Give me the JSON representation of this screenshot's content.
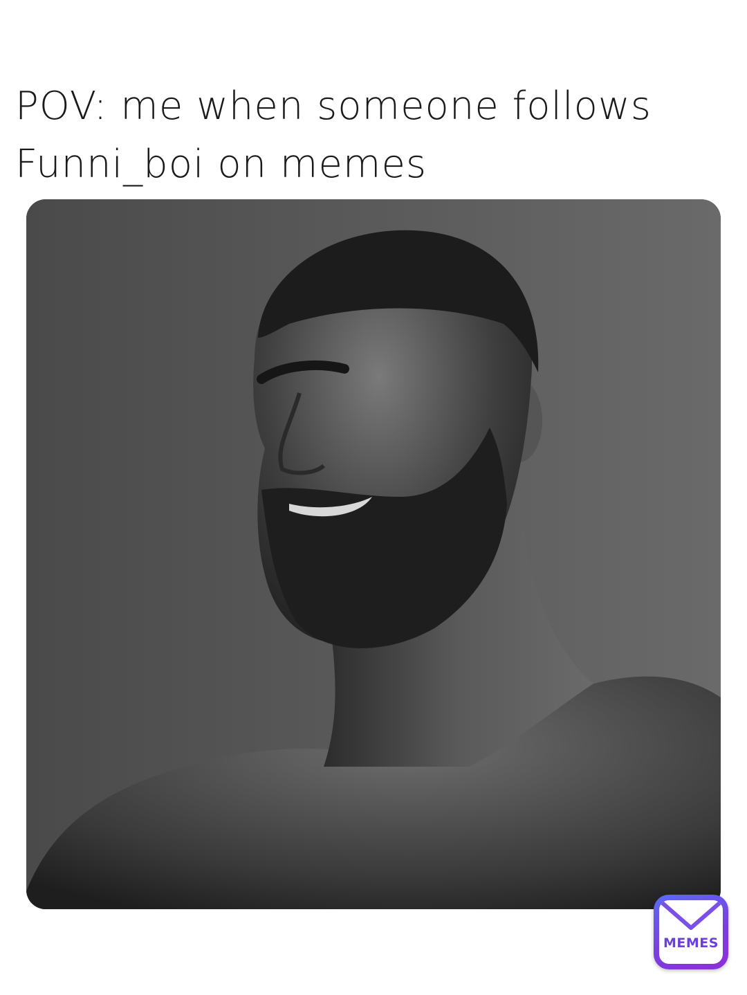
{
  "caption": {
    "line1": "POV: me when someone follows",
    "line2": "Funni_boi on memes"
  },
  "photo": {
    "subject": "grayscale portrait of a bearded muscular man smiling, head turned to the left"
  },
  "watermark": {
    "label": "MEMES",
    "icon": "envelope-icon",
    "colors": {
      "gradient_start": "#5a6cf0",
      "gradient_end": "#8d2fd6",
      "text": "#6a3fdc"
    }
  }
}
